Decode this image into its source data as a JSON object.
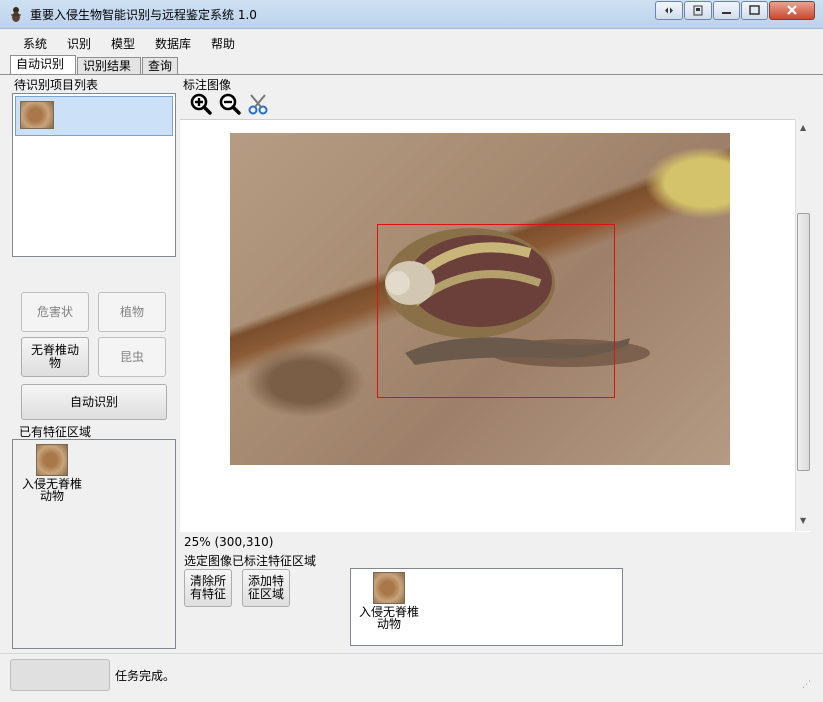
{
  "window": {
    "title": "重要入侵生物智能识别与远程鉴定系统 1.0"
  },
  "menu": [
    "系统",
    "识别",
    "模型",
    "数据库",
    "帮助"
  ],
  "tabs": [
    "自动识别",
    "识别结果",
    "查询"
  ],
  "left": {
    "pending_list_label": "待识别项目列表",
    "category_buttons": [
      "危害状",
      "植物",
      "无脊椎动\n物",
      "昆虫"
    ],
    "auto_identify_button": "自动识别",
    "existing_regions_label": "已有特征区域",
    "existing_region_item": "入侵无脊椎\n动物"
  },
  "annotate": {
    "label": "标注图像",
    "tools": [
      "zoom-in-icon",
      "zoom-out-icon",
      "scissors-icon"
    ],
    "status": "25%   (300,310)"
  },
  "selected": {
    "label": "选定图像已标注特征区域",
    "clear_button": "清除所\n有特征",
    "add_button": "添加特\n征区域",
    "region_item": "入侵无脊椎\n动物"
  },
  "statusbar": {
    "message": "任务完成。"
  },
  "colors": {
    "selection": "#e01010",
    "list_selection": "#cce0f7"
  }
}
